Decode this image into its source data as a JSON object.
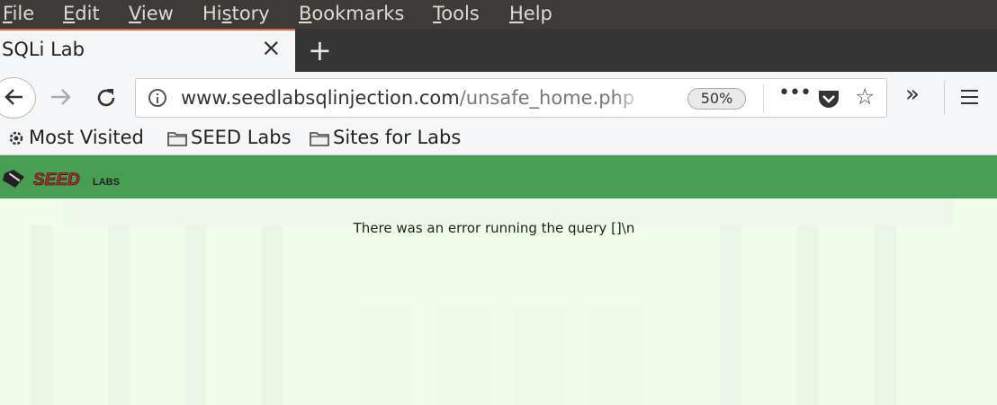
{
  "menubar": {
    "items": [
      {
        "label": "File",
        "mnemonic": "F",
        "rest": "ile"
      },
      {
        "label": "Edit",
        "mnemonic": "E",
        "rest": "dit"
      },
      {
        "label": "View",
        "mnemonic": "V",
        "rest": "iew"
      },
      {
        "label": "History",
        "mnemonic": "s",
        "pre": "Hi",
        "rest": "tory"
      },
      {
        "label": "Bookmarks",
        "mnemonic": "B",
        "rest": "ookmarks"
      },
      {
        "label": "Tools",
        "mnemonic": "T",
        "rest": "ools"
      },
      {
        "label": "Help",
        "mnemonic": "H",
        "rest": "elp"
      }
    ]
  },
  "tab": {
    "title": "SQLi Lab",
    "close": "×",
    "new_tab": "+"
  },
  "navbar": {
    "url_host": "www.seedlabsqlinjection.com",
    "url_path": "/unsafe_home.php",
    "zoom": "50%",
    "more": "•••",
    "overflow": "»",
    "star": "☆"
  },
  "bookmarks": [
    {
      "label": "Most Visited",
      "icon": "gear-icon"
    },
    {
      "label": "SEED Labs",
      "icon": "folder-icon"
    },
    {
      "label": "Sites for Labs",
      "icon": "folder-icon"
    }
  ],
  "page": {
    "brand": "SEEDLabs",
    "error_message": "There was an error running the query []\\n",
    "header_color": "#489f53",
    "background_color": "#f1fdeb"
  }
}
